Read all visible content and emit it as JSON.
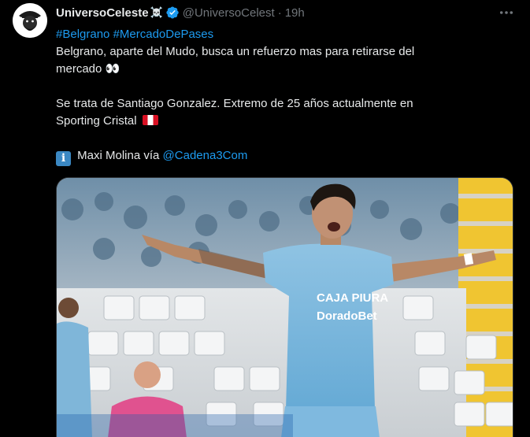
{
  "author": {
    "display_name": "UniversoCeleste",
    "name_emoji": "☠️",
    "handle": "@UniversoCelest",
    "separator": "·",
    "time": "19h",
    "verified": true
  },
  "tweet": {
    "hashtag_1": "#Belgrano",
    "hashtag_2": "#MercadoDePases",
    "line_1": "Belgrano, aparte del Mudo, busca un refuerzo mas para retirarse del",
    "line_2": "mercado 👀",
    "line_3": "Se trata de Santiago Gonzalez. Extremo de 25 años actualmente en",
    "line_4": "Sporting Cristal",
    "credit_prefix": "Maxi Molina vía",
    "mention": "@Cadena3Com",
    "info_glyph": "i"
  },
  "media": {
    "jersey_sponsor_1": "CAJA PIURA",
    "jersey_sponsor_2": "DoradoBet"
  },
  "colors": {
    "background": "#000000",
    "text": "#e7e9ea",
    "muted": "#71767b",
    "link": "#1d9bf0",
    "verified": "#1d9bf0"
  },
  "icons": {
    "avatar": "pirate-avatar",
    "verified": "verified-badge-icon",
    "more": "more-options-icon",
    "flag": "peru-flag-icon",
    "info": "info-icon"
  }
}
